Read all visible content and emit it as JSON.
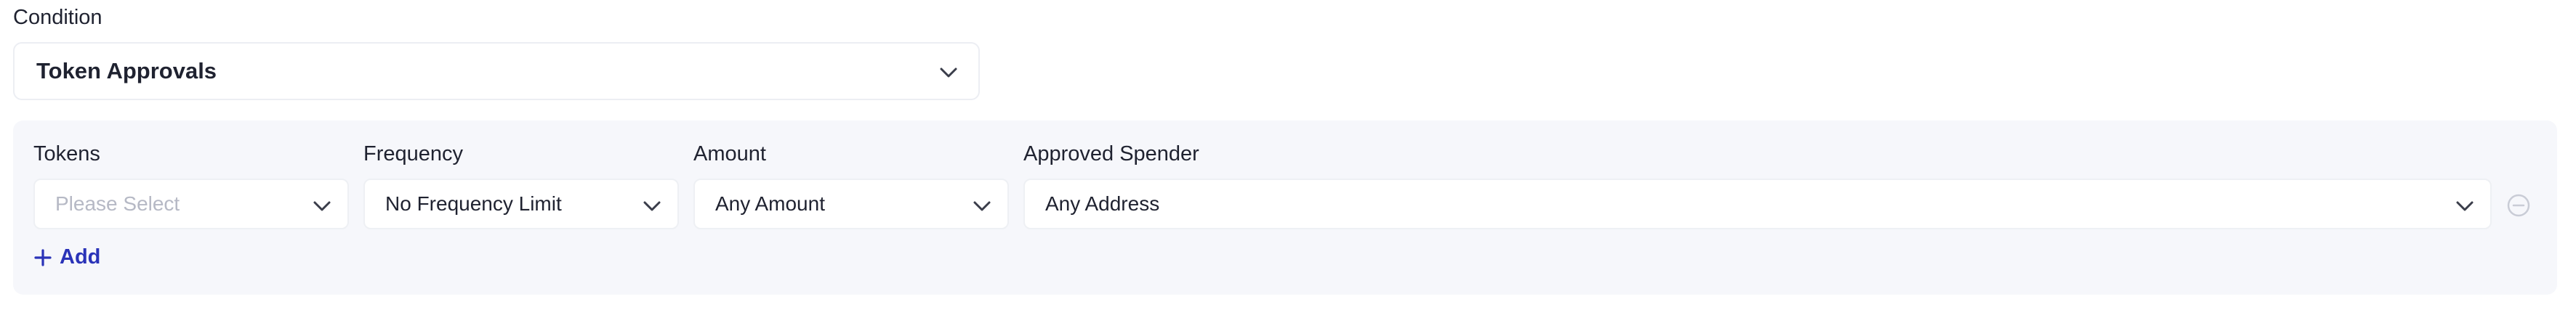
{
  "condition": {
    "label": "Condition",
    "selected": "Token Approvals",
    "icon": "chevron-down-icon"
  },
  "rule": {
    "fields": [
      {
        "label": "Tokens",
        "value": "Please Select",
        "is_placeholder": true
      },
      {
        "label": "Frequency",
        "value": "No Frequency Limit",
        "is_placeholder": false
      },
      {
        "label": "Amount",
        "value": "Any Amount",
        "is_placeholder": false
      },
      {
        "label": "Approved Spender",
        "value": "Any Address",
        "is_placeholder": false
      }
    ],
    "remove_icon": "minus-circle-icon",
    "add_label": "Add",
    "add_icon": "plus-icon"
  },
  "colors": {
    "accent": "#2a33b8",
    "panel_bg": "#f6f7fb",
    "placeholder": "#b6b9c5",
    "border": "#eceef3"
  }
}
